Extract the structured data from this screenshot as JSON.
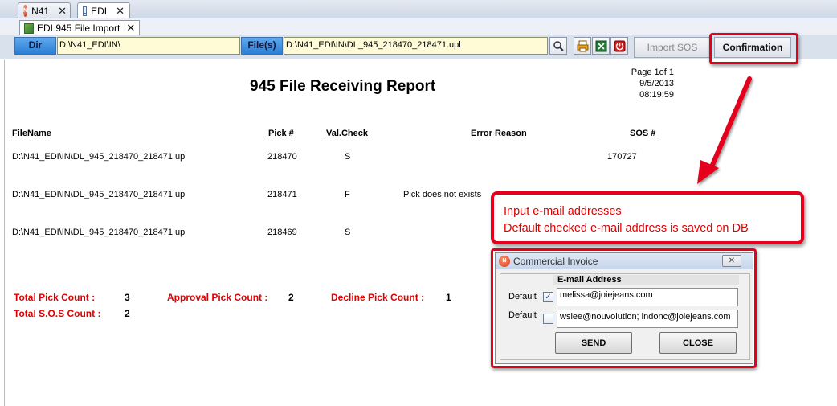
{
  "tabs": [
    {
      "label": "N41",
      "icon": "app-logo-icon"
    },
    {
      "label": "EDI",
      "icon": "grid-icon"
    }
  ],
  "subtab": {
    "label": "EDI 945 File Import",
    "icon": "document-import-icon"
  },
  "toolbar": {
    "dir_label": "Dir",
    "dir_value": "D:\\N41_EDI\\IN\\",
    "files_label": "File(s)",
    "files_value": "D:\\N41_EDI\\IN\\DL_945_218470_218471.upl",
    "import_sos_label": "Import SOS",
    "confirmation_label": "Confirmation"
  },
  "report": {
    "title": "945 File Receiving Report",
    "page": "Page 1of 1",
    "datetime": "9/5/2013 08:19:59",
    "columns": [
      "FileName",
      "Pick #",
      "Val.Check",
      "Error Reason",
      "SOS #"
    ],
    "rows": [
      {
        "file": "D:\\N41_EDI\\IN\\DL_945_218470_218471.upl",
        "pick": "218470",
        "check": "S",
        "error": "",
        "sos": "170727"
      },
      {
        "file": "D:\\N41_EDI\\IN\\DL_945_218470_218471.upl",
        "pick": "218471",
        "check": "F",
        "error": "Pick does not exists",
        "sos": ""
      },
      {
        "file": "D:\\N41_EDI\\IN\\DL_945_218470_218471.upl",
        "pick": "218469",
        "check": "S",
        "error": "",
        "sos": ""
      }
    ],
    "summary": {
      "total_pick_label": "Total Pick Count :",
      "total_pick_value": "3",
      "approval_label": "Approval Pick Count :",
      "approval_value": "2",
      "decline_label": "Decline Pick Count :",
      "decline_value": "1",
      "total_sos_label": "Total S.O.S Count :",
      "total_sos_value": "2"
    }
  },
  "callout": {
    "line1": "Input e-mail addresses",
    "line2": "Default checked e-mail address is saved on DB"
  },
  "dialog": {
    "title": "Commercial Invoice",
    "column_header": "E-mail Address",
    "rows": [
      {
        "label": "Default",
        "checked": true,
        "email": "melissa@joiejeans.com"
      },
      {
        "label": "Default",
        "checked": false,
        "email": "wslee@nouvolution; indonc@joiejeans.com"
      }
    ],
    "send_label": "SEND",
    "close_label": "CLOSE"
  },
  "colors": {
    "accent_red": "#e4001b",
    "label_blue": "#2a7fd6",
    "input_yellow": "#fffbd6"
  }
}
